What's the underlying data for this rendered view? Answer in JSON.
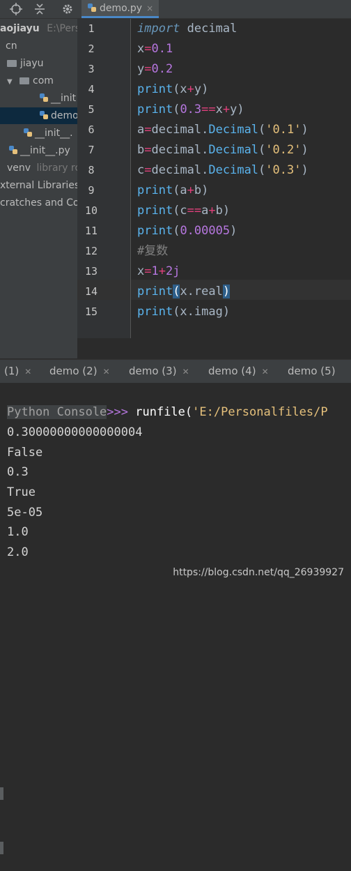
{
  "project_toolbar": {
    "icons": [
      "target-icon",
      "collapse-icon",
      "gear-icon"
    ]
  },
  "project_tree": {
    "items": [
      {
        "label": "aojiayu",
        "suffix": "E:\\Pers"
      },
      {
        "label": "cn"
      },
      {
        "label": "jiayu"
      },
      {
        "label": "com"
      },
      {
        "label": "__init"
      },
      {
        "label": "demo"
      },
      {
        "label": "__init__."
      },
      {
        "label": "__init__.py"
      },
      {
        "label": "venv",
        "suffix": "library ro"
      },
      {
        "label": "xternal Libraries"
      },
      {
        "label": "cratches and Co"
      }
    ]
  },
  "editor": {
    "tab_label": "demo.py",
    "tab_close": "×",
    "current_line": 14,
    "line_numbers": [
      "1",
      "2",
      "3",
      "4",
      "5",
      "6",
      "7",
      "8",
      "9",
      "10",
      "11",
      "12",
      "13",
      "14",
      "15"
    ]
  },
  "code": {
    "l1": {
      "a": "import",
      "b": " decimal"
    },
    "l2": {
      "a": "x",
      "b": "=",
      "c": "0.1"
    },
    "l3": {
      "a": "y",
      "b": "=",
      "c": "0.2"
    },
    "l4": {
      "a": "print",
      "b": "(x",
      "c": "+",
      "d": "y)"
    },
    "l5": {
      "a": "print",
      "b": "(",
      "c": "0.3",
      "d": "==",
      "e": "x",
      "f": "+",
      "g": "y)"
    },
    "l6": {
      "a": "a",
      "b": "=",
      "c": "decimal.",
      "d": "Decimal",
      "e": "(",
      "f": "'0.1'",
      "g": ")"
    },
    "l7": {
      "a": "b",
      "b": "=",
      "c": "decimal.",
      "d": "Decimal",
      "e": "(",
      "f": "'0.2'",
      "g": ")"
    },
    "l8": {
      "a": "c",
      "b": "=",
      "c": "decimal.",
      "d": "Decimal",
      "e": "(",
      "f": "'0.3'",
      "g": ")"
    },
    "l9": {
      "a": "print",
      "b": "(a",
      "c": "+",
      "d": "b)"
    },
    "l10": {
      "a": "print",
      "b": "(c",
      "c": "==",
      "d": "a",
      "e": "+",
      "f": "b)"
    },
    "l11": {
      "a": "print",
      "b": "(",
      "c": "0.00005",
      "d": ")"
    },
    "l12": {
      "a": "#复数"
    },
    "l13": {
      "a": "x",
      "b": "=",
      "c": "1",
      "d": "+",
      "e": "2j"
    },
    "l14": {
      "a": "print",
      "b": "(",
      "c": "x.real",
      "d": ")"
    },
    "l15": {
      "a": "print",
      "b": "(x.imag)"
    }
  },
  "console_tabs": [
    "(1)",
    "demo (2)",
    "demo (3)",
    "demo (4)",
    "demo (5)"
  ],
  "console": {
    "prompt_label": "Python Console",
    "prompt_arrows": ">>>",
    "command_prefix": " runfile(",
    "command_string": "'E:/Personalfiles/P",
    "outputs": [
      "0.30000000000000004",
      "False",
      "0.3",
      "True",
      "5e-05",
      "1.0",
      "2.0"
    ]
  },
  "watermark": "https://blog.csdn.net/qq_26939927",
  "colors": {
    "background": "#2b2b2b",
    "panel": "#3c3f41",
    "number": "#b777e0",
    "operator": "#e0407b",
    "function": "#5ab4ee",
    "string": "#e5c07b",
    "keyword": "#6897bb"
  }
}
